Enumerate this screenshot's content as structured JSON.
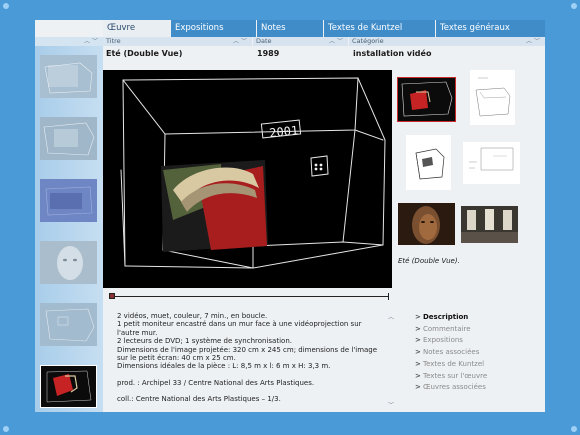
{
  "tabs": [
    "Œuvre",
    "Expositions",
    "Notes",
    "Textes de Kuntzel",
    "Textes généraux"
  ],
  "columns": {
    "titre": "Titre",
    "date": "Date",
    "categorie": "Catégorie"
  },
  "work": {
    "title": "Eté (Double Vue)",
    "year": "1989",
    "category": "installation vidéo"
  },
  "timecode_sketch": "2001",
  "caption": "Eté (Double Vue).",
  "description": {
    "lines": [
      "2 vidéos, muet, couleur, 7 min., en boucle.",
      "1 petit moniteur encastré dans un mur face à une vidéoprojection sur l'autre mur.",
      "2 lecteurs de DVD; 1 système de synchronisation.",
      "Dimensions de l'image projetée: 320 cm x 245 cm; dimensions de l'image sur le petit écran: 40 cm x 25 cm.",
      "Dimensions idéales de la pièce : L: 8,5 m x l: 6 m x H: 3,3 m."
    ],
    "prod": "prod. : Archipel 33 / Centre National des Arts Plastiques.",
    "coll": "coll.: Centre National des Arts Plastiques – 1/3."
  },
  "menu": [
    {
      "label": "Description",
      "active": true
    },
    {
      "label": "Commentaire",
      "active": false
    },
    {
      "label": "Expositions",
      "active": false
    },
    {
      "label": "Notes associées",
      "active": false
    },
    {
      "label": "Textes de Kuntzel",
      "active": false
    },
    {
      "label": "Textes sur l'œuvre",
      "active": false
    },
    {
      "label": "Œuvres associées",
      "active": false
    }
  ],
  "icons": {
    "scroll_up": "chevron-up-icon",
    "scroll_down": "chevron-down-icon",
    "menu_arrow": "chevron-right-icon"
  },
  "colors": {
    "frame": "#4a9ad8",
    "tab": "#3f8cc9",
    "panel": "#eef1f4",
    "thumb_selected": "#cc2a2a"
  }
}
